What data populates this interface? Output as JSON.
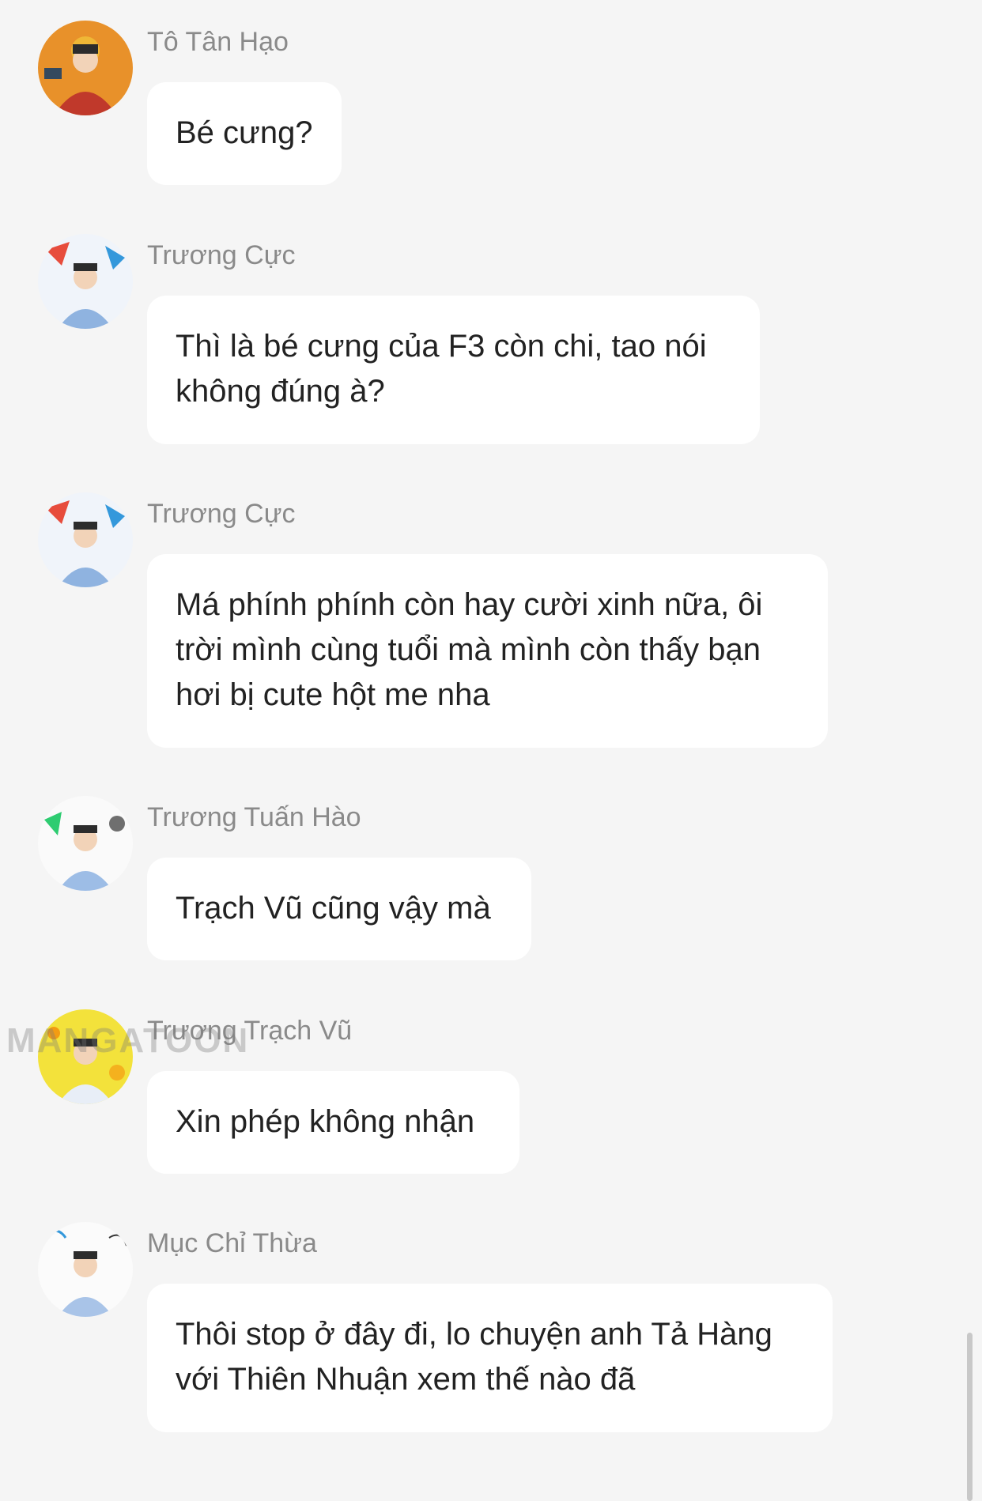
{
  "messages": [
    {
      "sender": "Tô Tân Hạo",
      "text": "Bé cưng?",
      "avatar_colors": [
        "#e8912a",
        "#c0392b",
        "#f4d03f"
      ]
    },
    {
      "sender": "Trương Cực",
      "text": "Thì là bé cưng của F3 còn chi, tao nói\nkhông đúng à?",
      "avatar_colors": [
        "#f0f4fa",
        "#8fb3e0",
        "#e74c3c"
      ]
    },
    {
      "sender": "Trương Cực",
      "text": "Má phính phính còn hay cười xinh nữa, ôi\ntrời mình cùng tuổi mà mình còn thấy bạn\nhơi bị cute hột me nha",
      "avatar_colors": [
        "#f0f4fa",
        "#8fb3e0",
        "#e74c3c"
      ]
    },
    {
      "sender": "Trương Tuấn Hào",
      "text": "Trạch Vũ cũng vậy mà",
      "avatar_colors": [
        "#fafafa",
        "#9dbde6",
        "#2ecc71"
      ]
    },
    {
      "sender": "Trương Trạch Vũ",
      "text": "Xin phép không nhận",
      "avatar_colors": [
        "#f3e23b",
        "#e8eef7",
        "#f39c12"
      ]
    },
    {
      "sender": "Mục Chỉ Thừa",
      "text": "Thôi stop ở đây đi, lo chuyện anh Tả Hàng\nvới Thiên Nhuận xem thế nào đã",
      "avatar_colors": [
        "#fbfbfb",
        "#a9c4e8",
        "#3498db"
      ]
    }
  ],
  "watermark": "MANGATOON"
}
